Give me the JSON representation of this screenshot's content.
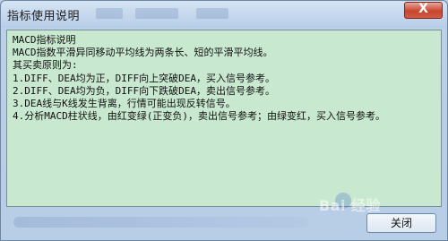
{
  "window": {
    "title": "指标使用说明",
    "close_glyph": "X"
  },
  "content": {
    "lines": [
      "MACD指标说明",
      "MACD指数平滑异同移动平均线为两条长、短的平滑平均线。",
      "其买卖原则为:",
      "1.DIFF、DEA均为正，DIFF向上突破DEA，买入信号参考。",
      "2.DIFF、DEA均为负，DIFF向下跌破DEA，卖出信号参考。",
      "3.DEA线与K线发生背离，行情可能出现反转信号。",
      "4.分析MACD柱状线，由红变绿(正变负)，卖出信号参考；由绿变红，买入信号参考。"
    ]
  },
  "footer": {
    "close_label": "关闭",
    "watermark": "Bai 经验"
  }
}
